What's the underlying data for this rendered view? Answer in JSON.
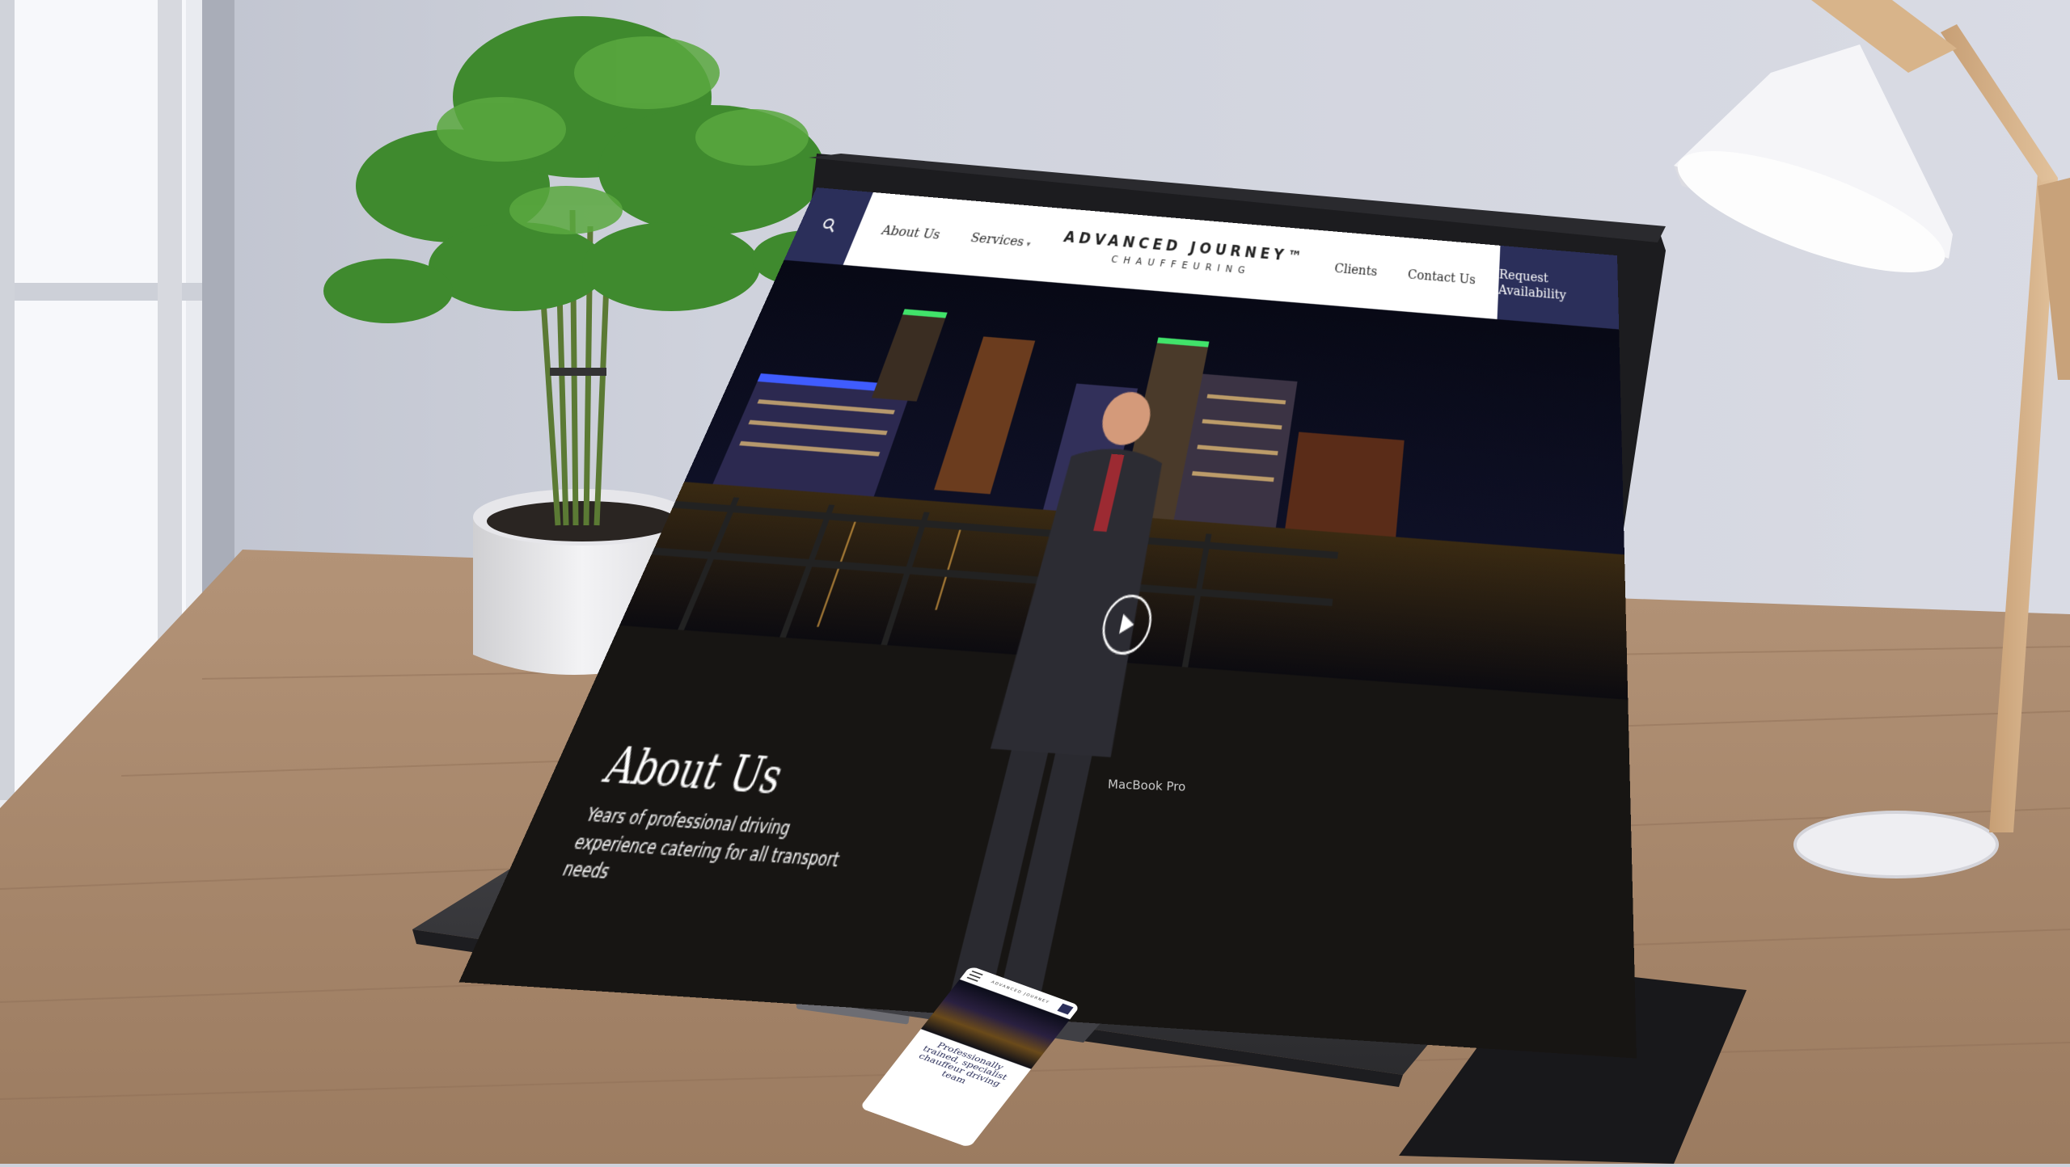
{
  "website": {
    "nav": {
      "search_icon": "search-icon",
      "links": [
        "About Us",
        "Services",
        "Clients",
        "Contact Us"
      ],
      "logo_line1": "ADVANCED JOURNEY™",
      "logo_line2": "CHAUFFEURING",
      "cta": "Request Availability"
    },
    "hero": {
      "title": "About Us",
      "subtitle": "Years of professional driving experience catering for all transport needs",
      "play_icon": "play-icon"
    }
  },
  "laptop_label": "MacBook Pro",
  "phone": {
    "logo": "ADVANCED JOURNEY",
    "headline": "Professionally trained, specialist chauffeur driving team",
    "body": ""
  },
  "colors": {
    "brand_navy": "#2b2f5a",
    "desk_wood": "#a9896c",
    "wall": "#cfd2dc"
  }
}
